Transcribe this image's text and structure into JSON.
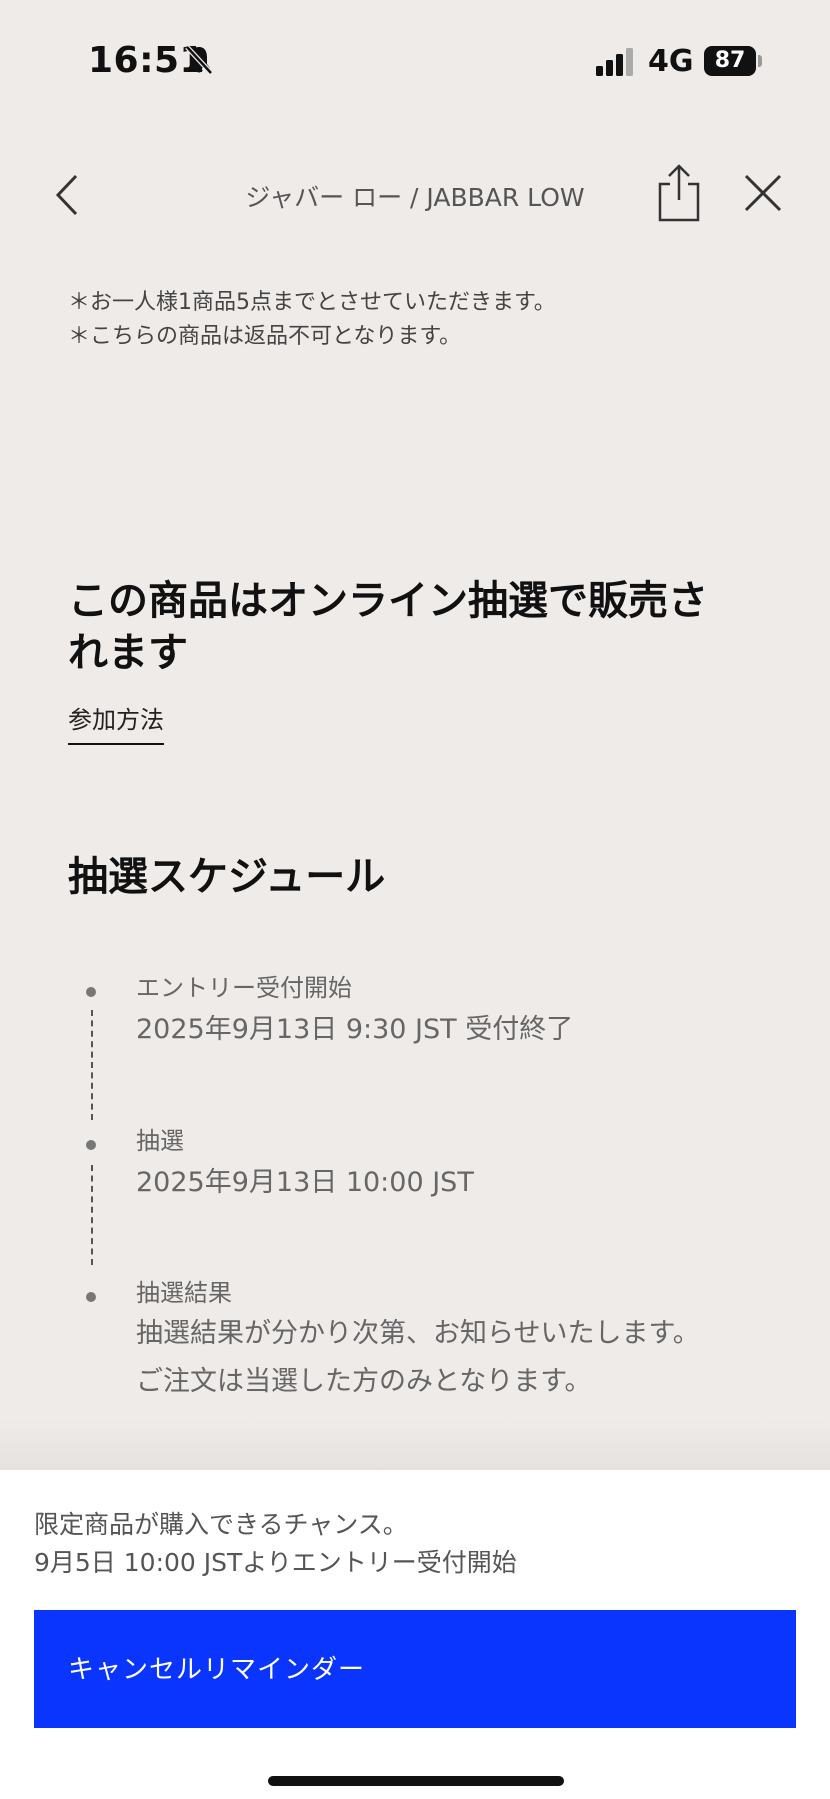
{
  "status_bar": {
    "time": "16:51",
    "network": "4G",
    "battery": "87"
  },
  "header": {
    "title": "ジャバー ロー / JABBAR LOW"
  },
  "notes": [
    "＊お一人様1商品5点までとさせていただきます。",
    "＊こちらの商品は返品不可となります。"
  ],
  "lottery": {
    "heading_line1": "この商品はオンライン抽選で販売さ",
    "heading_line2": "れます",
    "how_to_link": "参加方法"
  },
  "schedule": {
    "heading": "抽選スケジュール",
    "steps": [
      {
        "label": "エントリー受付開始",
        "details": [
          "2025年9月13日 9:30 JST 受付終了"
        ]
      },
      {
        "label": "抽選",
        "details": [
          "2025年9月13日 10:00 JST"
        ]
      },
      {
        "label": "抽選結果",
        "details": [
          "抽選結果が分かり次第、お知らせいたします。",
          "ご注文は当選した方のみとなります。"
        ]
      }
    ]
  },
  "bottom_panel": {
    "line1": "限定商品が購入できるチャンス。",
    "line2": "9月5日 10:00 JSTよりエントリー受付開始",
    "button_label": "キャンセルリマインダー"
  },
  "colors": {
    "background": "#efebe9",
    "accent": "#0a35ff"
  }
}
